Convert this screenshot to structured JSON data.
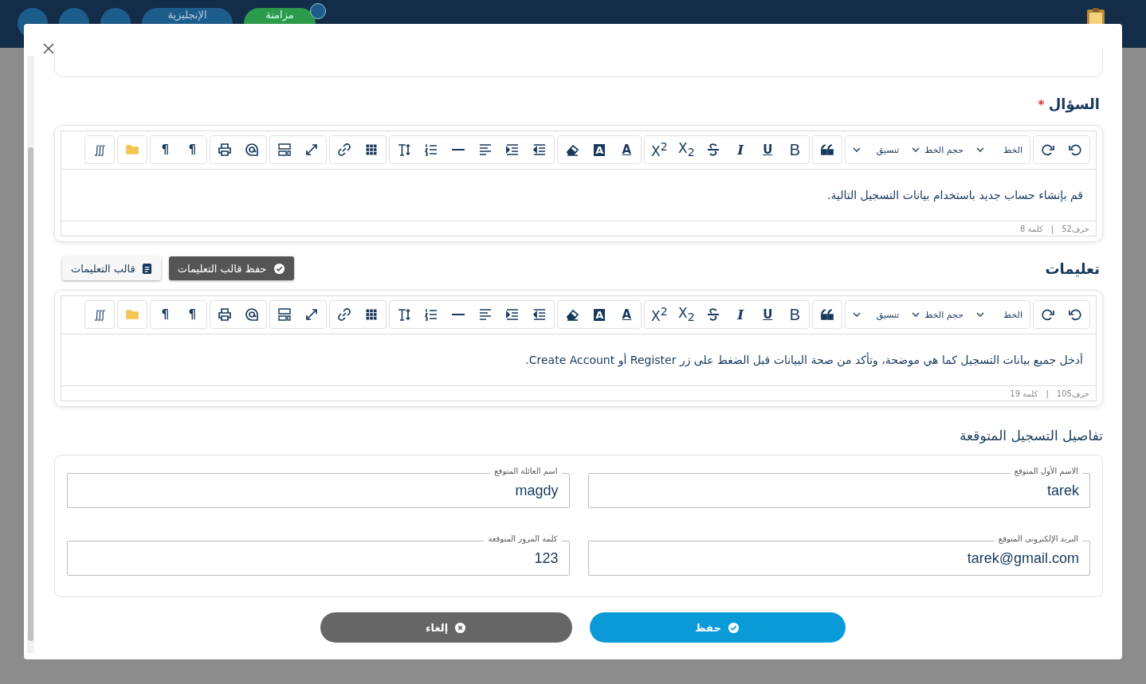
{
  "background_header": {
    "language_button": "الإنجليزية",
    "sync_button": "مزامنة"
  },
  "editors": [
    {
      "title": "السؤال",
      "required_mark": "*",
      "toolbar": [
        [
          {
            "kind": "undo"
          },
          {
            "kind": "redo"
          }
        ],
        [
          {
            "kind": "select",
            "label": "الخط"
          },
          {
            "kind": "select",
            "label": "حجم الخط"
          },
          {
            "kind": "select",
            "label": "تنسيق"
          }
        ],
        [
          {
            "kind": "quote"
          }
        ],
        [
          {
            "kind": "bold",
            "glyph": "B"
          },
          {
            "kind": "underline",
            "glyph": "U"
          },
          {
            "kind": "italic",
            "glyph": "I"
          },
          {
            "kind": "strike"
          },
          {
            "kind": "sub",
            "glyph": "X$_{2}$"
          },
          {
            "kind": "sup",
            "glyph": "X$^{2}$"
          }
        ],
        [
          {
            "kind": "color",
            "glyph": "A"
          },
          {
            "kind": "highlight",
            "glyph": "A"
          },
          {
            "kind": "eraser"
          }
        ],
        [
          {
            "kind": "outdent"
          },
          {
            "kind": "indent"
          },
          {
            "kind": "align"
          },
          {
            "kind": "rule"
          },
          {
            "kind": "list"
          },
          {
            "kind": "fontsize"
          }
        ],
        [
          {
            "kind": "table"
          },
          {
            "kind": "link"
          }
        ],
        [
          {
            "kind": "fullscreen"
          },
          {
            "kind": "layout"
          }
        ],
        [
          {
            "kind": "mention"
          },
          {
            "kind": "print"
          }
        ],
        [
          {
            "kind": "pilcrow",
            "glyph": "¶"
          },
          {
            "kind": "pilcrow",
            "glyph": "¶"
          }
        ],
        [
          {
            "kind": "folder"
          }
        ],
        [
          {
            "kind": "math",
            "glyph": "∭"
          }
        ]
      ],
      "content": "قم بإنشاء حساب جديد باستخدام بيانات التسجيل التالية.",
      "footer": {
        "chars": "حرف52",
        "separator": "|",
        "words": "كلمة 8"
      }
    },
    {
      "title": "تعليمات",
      "actions": [
        {
          "kind": "primary",
          "label": "حفظ قالب التعليمات"
        },
        {
          "kind": "secondary",
          "label": "قالب التعليمات"
        }
      ],
      "toolbar": [
        [
          {
            "kind": "undo"
          },
          {
            "kind": "redo"
          }
        ],
        [
          {
            "kind": "select",
            "label": "الخط"
          },
          {
            "kind": "select",
            "label": "حجم الخط"
          },
          {
            "kind": "select",
            "label": "تنسيق"
          }
        ],
        [
          {
            "kind": "quote"
          }
        ],
        [
          {
            "kind": "bold",
            "glyph": "B"
          },
          {
            "kind": "underline",
            "glyph": "U"
          },
          {
            "kind": "italic",
            "glyph": "I"
          },
          {
            "kind": "strike"
          },
          {
            "kind": "sub",
            "glyph": "X$_{2}$"
          },
          {
            "kind": "sup",
            "glyph": "X$^{2}$"
          }
        ],
        [
          {
            "kind": "color",
            "glyph": "A"
          },
          {
            "kind": "highlight",
            "glyph": "A"
          },
          {
            "kind": "eraser"
          }
        ],
        [
          {
            "kind": "outdent"
          },
          {
            "kind": "indent"
          },
          {
            "kind": "align"
          },
          {
            "kind": "rule"
          },
          {
            "kind": "list"
          },
          {
            "kind": "fontsize"
          }
        ],
        [
          {
            "kind": "table"
          },
          {
            "kind": "link"
          }
        ],
        [
          {
            "kind": "fullscreen"
          },
          {
            "kind": "layout"
          }
        ],
        [
          {
            "kind": "mention"
          },
          {
            "kind": "print"
          }
        ],
        [
          {
            "kind": "pilcrow",
            "glyph": "¶"
          },
          {
            "kind": "pilcrow",
            "glyph": "¶"
          }
        ],
        [
          {
            "kind": "folder"
          }
        ],
        [
          {
            "kind": "math",
            "glyph": "∭"
          }
        ]
      ],
      "content": "أدخل جميع بيانات التسجيل كما هي موضحة، وتأكد من صحة البيانات قبل الضغط على زر Register أو Create Account.",
      "footer": {
        "chars": "حرف105",
        "separator": "|",
        "words": "كلمة 19"
      }
    }
  ],
  "registration": {
    "title": "تفاصيل التسجيل المتوقعة",
    "fields": [
      {
        "label": "الاسم الأول المتوقع",
        "value": "tarek"
      },
      {
        "label": "اسم العائلة المتوقع",
        "value": "magdy"
      },
      {
        "label": "البريد الإلكترونى المتوقع",
        "value": "tarek@gmail.com"
      },
      {
        "label": "كلمة المرور المتوقعة",
        "value": "123"
      }
    ]
  },
  "buttons": [
    {
      "kind": "save",
      "label": "حفظ"
    },
    {
      "kind": "cancel",
      "label": "إلغاء"
    }
  ]
}
